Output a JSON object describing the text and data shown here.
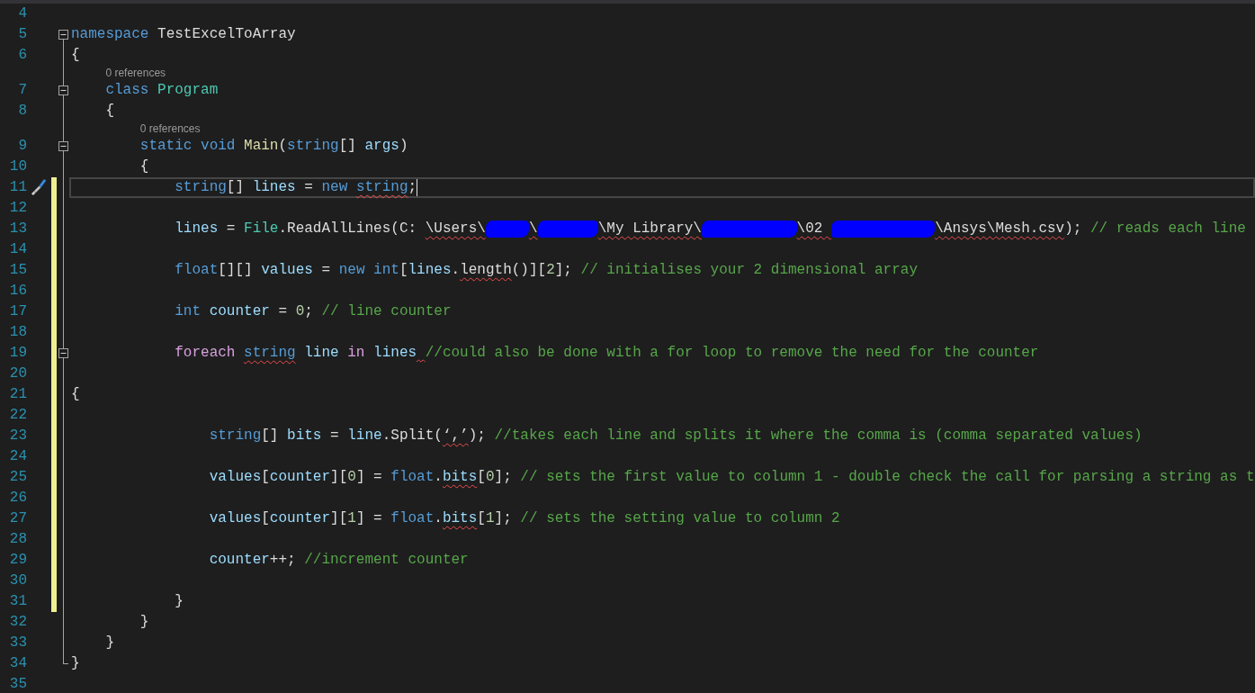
{
  "editor": {
    "lines": [
      {
        "number": "4",
        "collapsible": false,
        "changed": false,
        "current": false,
        "action_icon": false
      },
      {
        "number": "5",
        "collapsible": true,
        "changed": false,
        "current": false,
        "action_icon": false,
        "tokens": [
          {
            "kind": "keyword",
            "text": "namespace",
            "error": false
          },
          {
            "kind": "plain",
            "text": " TestExcelToArray",
            "error": false
          }
        ]
      },
      {
        "number": "6",
        "collapsible": false,
        "changed": false,
        "current": false,
        "action_icon": false,
        "tokens": [
          {
            "kind": "plain",
            "text": "{",
            "error": false
          }
        ]
      },
      {
        "number": "7",
        "collapsible": true,
        "changed": false,
        "current": false,
        "action_icon": false,
        "codelens": "0 references",
        "tokens": [
          {
            "kind": "keyword",
            "text": "    class",
            "error": false
          },
          {
            "kind": "type",
            "text": " Program",
            "error": false
          }
        ]
      },
      {
        "number": "8",
        "collapsible": false,
        "changed": false,
        "current": false,
        "action_icon": false,
        "tokens": [
          {
            "kind": "plain",
            "text": "    {",
            "error": false
          }
        ]
      },
      {
        "number": "9",
        "collapsible": true,
        "changed": false,
        "current": false,
        "action_icon": false,
        "codelens": "0 references",
        "tokens": [
          {
            "kind": "keyword",
            "text": "        static void",
            "error": false
          },
          {
            "kind": "function",
            "text": " Main",
            "error": false
          },
          {
            "kind": "plain",
            "text": "(",
            "error": false
          },
          {
            "kind": "keyword",
            "text": "string",
            "error": false
          },
          {
            "kind": "plain",
            "text": "[] ",
            "error": false
          },
          {
            "kind": "variable",
            "text": "args",
            "error": false
          },
          {
            "kind": "plain",
            "text": ")",
            "error": false
          }
        ]
      },
      {
        "number": "10",
        "collapsible": false,
        "changed": false,
        "current": false,
        "action_icon": false,
        "tokens": [
          {
            "kind": "plain",
            "text": "        {",
            "error": false
          }
        ]
      },
      {
        "number": "11",
        "collapsible": false,
        "changed": true,
        "current": true,
        "action_icon": true,
        "tokens": [
          {
            "kind": "keyword",
            "text": "            string",
            "error": false
          },
          {
            "kind": "plain",
            "text": "[] ",
            "error": false
          },
          {
            "kind": "variable",
            "text": "lines",
            "error": false
          },
          {
            "kind": "plain",
            "text": " = ",
            "error": false
          },
          {
            "kind": "keyword",
            "text": "new ",
            "error": false
          },
          {
            "kind": "keyword",
            "text": "string",
            "error": true
          },
          {
            "kind": "plain",
            "text": ";",
            "error": false
          }
        ]
      },
      {
        "number": "12",
        "collapsible": false,
        "changed": true,
        "current": false,
        "action_icon": false
      },
      {
        "number": "13",
        "collapsible": false,
        "changed": true,
        "current": false,
        "action_icon": false,
        "tokens": [
          {
            "kind": "variable",
            "text": "            lines",
            "error": false
          },
          {
            "kind": "plain",
            "text": " = ",
            "error": false
          },
          {
            "kind": "type",
            "text": "File",
            "error": false
          },
          {
            "kind": "plain",
            "text": ".ReadAllLines(C: ",
            "error": false
          },
          {
            "kind": "plain",
            "text": "\\Users\\",
            "error": true
          },
          {
            "kind": "redacted"
          },
          {
            "kind": "plain",
            "text": "\\",
            "error": true
          },
          {
            "kind": "redacted"
          },
          {
            "kind": "plain",
            "text": "\\My Library\\",
            "error": true
          },
          {
            "kind": "redacted"
          },
          {
            "kind": "plain",
            "text": "\\02 ",
            "error": true
          },
          {
            "kind": "redacted"
          },
          {
            "kind": "plain",
            "text": "\\Ansys\\Mesh.csv",
            "error": true
          },
          {
            "kind": "plain",
            "text": "); ",
            "error": false
          },
          {
            "kind": "comment",
            "text": "// reads each line",
            "error": false
          }
        ]
      },
      {
        "number": "14",
        "collapsible": false,
        "changed": true,
        "current": false,
        "action_icon": false
      },
      {
        "number": "15",
        "collapsible": false,
        "changed": true,
        "current": false,
        "action_icon": false,
        "tokens": [
          {
            "kind": "keyword",
            "text": "            float",
            "error": false
          },
          {
            "kind": "plain",
            "text": "[][] ",
            "error": false
          },
          {
            "kind": "variable",
            "text": "values",
            "error": false
          },
          {
            "kind": "plain",
            "text": " = ",
            "error": false
          },
          {
            "kind": "keyword",
            "text": "new int",
            "error": false
          },
          {
            "kind": "plain",
            "text": "[",
            "error": false
          },
          {
            "kind": "variable",
            "text": "lines",
            "error": false
          },
          {
            "kind": "plain",
            "text": ".",
            "error": false
          },
          {
            "kind": "plain",
            "text": "length",
            "error": true
          },
          {
            "kind": "plain",
            "text": "()][",
            "error": false
          },
          {
            "kind": "number",
            "text": "2",
            "error": false
          },
          {
            "kind": "plain",
            "text": "]; ",
            "error": false
          },
          {
            "kind": "comment",
            "text": "// initialises your 2 dimensional array",
            "error": false
          }
        ]
      },
      {
        "number": "16",
        "collapsible": false,
        "changed": true,
        "current": false,
        "action_icon": false
      },
      {
        "number": "17",
        "collapsible": false,
        "changed": true,
        "current": false,
        "action_icon": false,
        "tokens": [
          {
            "kind": "keyword",
            "text": "            int",
            "error": false
          },
          {
            "kind": "variable",
            "text": " counter",
            "error": false
          },
          {
            "kind": "plain",
            "text": " = ",
            "error": false
          },
          {
            "kind": "number",
            "text": "0",
            "error": false
          },
          {
            "kind": "plain",
            "text": "; ",
            "error": false
          },
          {
            "kind": "comment",
            "text": "// line counter",
            "error": false
          }
        ]
      },
      {
        "number": "18",
        "collapsible": false,
        "changed": true,
        "current": false,
        "action_icon": false
      },
      {
        "number": "19",
        "collapsible": true,
        "changed": true,
        "current": false,
        "action_icon": false,
        "tokens": [
          {
            "kind": "control",
            "text": "            foreach ",
            "error": false
          },
          {
            "kind": "keyword",
            "text": "string",
            "error": true
          },
          {
            "kind": "variable",
            "text": " line",
            "error": false
          },
          {
            "kind": "control",
            "text": " in",
            "error": false
          },
          {
            "kind": "variable",
            "text": " lines",
            "error": false
          },
          {
            "kind": "squiggle"
          },
          {
            "kind": "comment",
            "text": "//could also be done with a for loop to remove the need for the counter",
            "error": false
          }
        ]
      },
      {
        "number": "20",
        "collapsible": false,
        "changed": true,
        "current": false,
        "action_icon": false
      },
      {
        "number": "21",
        "collapsible": false,
        "changed": true,
        "current": false,
        "action_icon": false,
        "tokens": [
          {
            "kind": "plain",
            "text": "{",
            "error": false
          }
        ]
      },
      {
        "number": "22",
        "collapsible": false,
        "changed": true,
        "current": false,
        "action_icon": false
      },
      {
        "number": "23",
        "collapsible": false,
        "changed": true,
        "current": false,
        "action_icon": false,
        "tokens": [
          {
            "kind": "keyword",
            "text": "                string",
            "error": false
          },
          {
            "kind": "plain",
            "text": "[] ",
            "error": false
          },
          {
            "kind": "variable",
            "text": "bits",
            "error": false
          },
          {
            "kind": "plain",
            "text": " = ",
            "error": false
          },
          {
            "kind": "variable",
            "text": "line",
            "error": false
          },
          {
            "kind": "plain",
            "text": ".Split(",
            "error": false
          },
          {
            "kind": "plain",
            "text": "‘,’",
            "error": true
          },
          {
            "kind": "plain",
            "text": "); ",
            "error": false
          },
          {
            "kind": "comment",
            "text": "//takes each line and splits it where the comma is (comma separated values)",
            "error": false
          }
        ]
      },
      {
        "number": "24",
        "collapsible": false,
        "changed": true,
        "current": false,
        "action_icon": false
      },
      {
        "number": "25",
        "collapsible": false,
        "changed": true,
        "current": false,
        "action_icon": false,
        "tokens": [
          {
            "kind": "variable",
            "text": "                values",
            "error": false
          },
          {
            "kind": "plain",
            "text": "[",
            "error": false
          },
          {
            "kind": "variable",
            "text": "counter",
            "error": false
          },
          {
            "kind": "plain",
            "text": "][",
            "error": false
          },
          {
            "kind": "number",
            "text": "0",
            "error": false
          },
          {
            "kind": "plain",
            "text": "] = ",
            "error": false
          },
          {
            "kind": "keyword",
            "text": "float",
            "error": false
          },
          {
            "kind": "plain",
            "text": ".",
            "error": false
          },
          {
            "kind": "variable",
            "text": "bits",
            "error": true
          },
          {
            "kind": "plain",
            "text": "[",
            "error": false
          },
          {
            "kind": "number",
            "text": "0",
            "error": false
          },
          {
            "kind": "plain",
            "text": "]; ",
            "error": false
          },
          {
            "kind": "comment",
            "text": "// sets the first value to column 1 - double check the call for parsing a string as t",
            "error": false
          }
        ]
      },
      {
        "number": "26",
        "collapsible": false,
        "changed": true,
        "current": false,
        "action_icon": false
      },
      {
        "number": "27",
        "collapsible": false,
        "changed": true,
        "current": false,
        "action_icon": false,
        "tokens": [
          {
            "kind": "variable",
            "text": "                values",
            "error": false
          },
          {
            "kind": "plain",
            "text": "[",
            "error": false
          },
          {
            "kind": "variable",
            "text": "counter",
            "error": false
          },
          {
            "kind": "plain",
            "text": "][",
            "error": false
          },
          {
            "kind": "number",
            "text": "1",
            "error": false
          },
          {
            "kind": "plain",
            "text": "] = ",
            "error": false
          },
          {
            "kind": "keyword",
            "text": "float",
            "error": false
          },
          {
            "kind": "plain",
            "text": ".",
            "error": false
          },
          {
            "kind": "variable",
            "text": "bits",
            "error": true
          },
          {
            "kind": "plain",
            "text": "[",
            "error": false
          },
          {
            "kind": "number",
            "text": "1",
            "error": false
          },
          {
            "kind": "plain",
            "text": "]; ",
            "error": false
          },
          {
            "kind": "comment",
            "text": "// sets the setting value to column 2",
            "error": false
          }
        ]
      },
      {
        "number": "28",
        "collapsible": false,
        "changed": true,
        "current": false,
        "action_icon": false
      },
      {
        "number": "29",
        "collapsible": false,
        "changed": true,
        "current": false,
        "action_icon": false,
        "tokens": [
          {
            "kind": "variable",
            "text": "                counter",
            "error": false
          },
          {
            "kind": "plain",
            "text": "++; ",
            "error": false
          },
          {
            "kind": "comment",
            "text": "//increment counter",
            "error": false
          }
        ]
      },
      {
        "number": "30",
        "collapsible": false,
        "changed": true,
        "current": false,
        "action_icon": false
      },
      {
        "number": "31",
        "collapsible": false,
        "changed": true,
        "current": false,
        "action_icon": false,
        "tokens": [
          {
            "kind": "plain",
            "text": "            }",
            "error": false
          }
        ]
      },
      {
        "number": "32",
        "collapsible": false,
        "changed": false,
        "current": false,
        "action_icon": false,
        "tokens": [
          {
            "kind": "plain",
            "text": "        }",
            "error": false
          }
        ]
      },
      {
        "number": "33",
        "collapsible": false,
        "changed": false,
        "current": false,
        "action_icon": false,
        "tokens": [
          {
            "kind": "plain",
            "text": "    }",
            "error": false
          }
        ]
      },
      {
        "number": "34",
        "collapsible": false,
        "changed": false,
        "current": false,
        "action_icon": false,
        "tokens": [
          {
            "kind": "plain",
            "text": "}",
            "error": false
          }
        ]
      },
      {
        "number": "35",
        "collapsible": false,
        "changed": false,
        "current": false,
        "action_icon": false
      }
    ]
  }
}
